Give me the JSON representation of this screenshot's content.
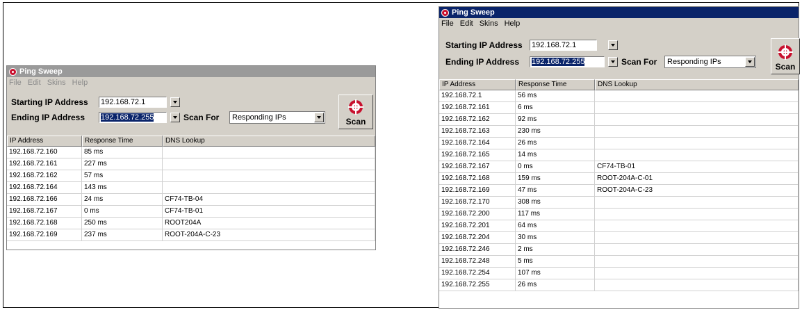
{
  "left_window": {
    "title": "Ping Sweep",
    "menu": [
      "File",
      "Edit",
      "Skins",
      "Help"
    ],
    "start_label": "Starting IP Address",
    "start_ip": "192.168.72.1",
    "end_label": "Ending IP Address",
    "end_ip": "192.168.72.255",
    "scan_for_label": "Scan For",
    "scan_for_value": "Responding IPs",
    "scan_label": "Scan",
    "columns": [
      "IP Address",
      "Response Time",
      "DNS Lookup"
    ],
    "rows": [
      [
        "192.168.72.160",
        "85 ms",
        ""
      ],
      [
        "192.168.72.161",
        "227 ms",
        ""
      ],
      [
        "192.168.72.162",
        "57 ms",
        ""
      ],
      [
        "192.168.72.164",
        "143 ms",
        ""
      ],
      [
        "192.168.72.166",
        "24 ms",
        "CF74-TB-04"
      ],
      [
        "192.168.72.167",
        "0 ms",
        "CF74-TB-01"
      ],
      [
        "192.168.72.168",
        "250 ms",
        "ROOT204A"
      ],
      [
        "192.168.72.169",
        "237 ms",
        "ROOT-204A-C-23"
      ]
    ]
  },
  "right_window": {
    "title": "Ping Sweep",
    "menu": [
      "File",
      "Edit",
      "Skins",
      "Help"
    ],
    "start_label": "Starting IP Address",
    "start_ip": "192.168.72.1",
    "end_label": "Ending IP Address",
    "end_ip": "192.168.72.255",
    "scan_for_label": "Scan For",
    "scan_for_value": "Responding IPs",
    "scan_label": "Scan",
    "columns": [
      "IP Address",
      "Response Time",
      "DNS Lookup"
    ],
    "rows": [
      [
        "192.168.72.1",
        "56 ms",
        ""
      ],
      [
        "192.168.72.161",
        "6 ms",
        ""
      ],
      [
        "192.168.72.162",
        "92 ms",
        ""
      ],
      [
        "192.168.72.163",
        "230 ms",
        ""
      ],
      [
        "192.168.72.164",
        "26 ms",
        ""
      ],
      [
        "192.168.72.165",
        "14 ms",
        ""
      ],
      [
        "192.168.72.167",
        "0 ms",
        "CF74-TB-01"
      ],
      [
        "192.168.72.168",
        "159 ms",
        "ROOT-204A-C-01"
      ],
      [
        "192.168.72.169",
        "47 ms",
        "ROOT-204A-C-23"
      ],
      [
        "192.168.72.170",
        "308 ms",
        ""
      ],
      [
        "192.168.72.200",
        "117 ms",
        ""
      ],
      [
        "192.168.72.201",
        "64 ms",
        ""
      ],
      [
        "192.168.72.204",
        "30 ms",
        ""
      ],
      [
        "192.168.72.246",
        "2 ms",
        ""
      ],
      [
        "192.168.72.248",
        "5 ms",
        ""
      ],
      [
        "192.168.72.254",
        "107 ms",
        ""
      ],
      [
        "192.168.72.255",
        "26 ms",
        ""
      ]
    ]
  },
  "colors": {
    "title_left": "#9a9a9a",
    "title_right": "#0a246a",
    "selection": "#0a246a",
    "target_red": "#c8102e"
  }
}
